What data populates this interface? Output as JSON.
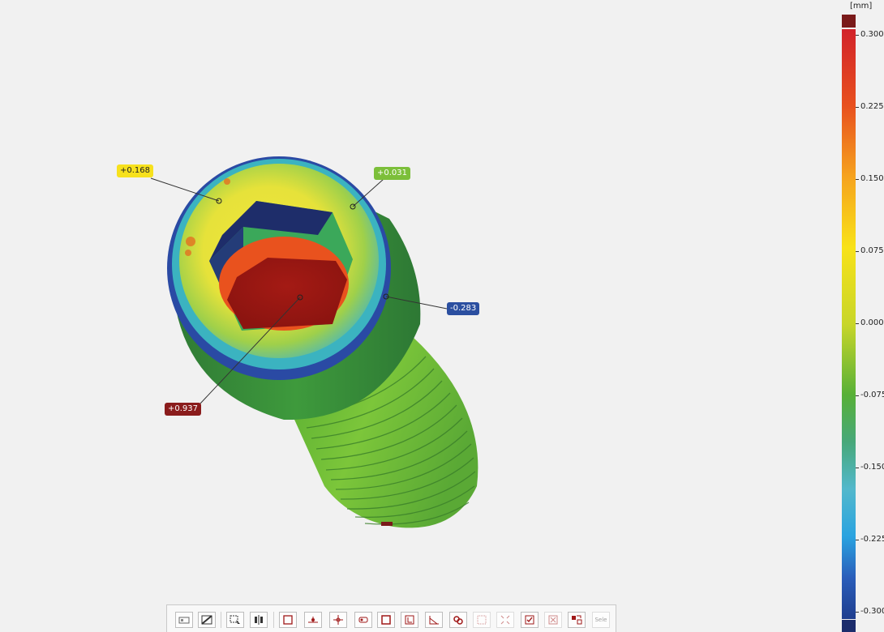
{
  "scale": {
    "unit": "[mm]",
    "ticks": [
      "0.300",
      "0.225",
      "0.150",
      "0.075",
      "0.000",
      "-0.075",
      "-0.150",
      "-0.225",
      "-0.300"
    ],
    "colors": {
      "over": "#7a1a1a",
      "under": "#1c2c6c"
    }
  },
  "labels": {
    "yellow": {
      "text": "+0.168",
      "bg": "#f7e11d",
      "fg": "#222222"
    },
    "green": {
      "text": "+0.031",
      "bg": "#7cbf3a",
      "fg": "#ffffff"
    },
    "blue": {
      "text": "-0.283",
      "bg": "#2b4fa0",
      "fg": "#ffffff"
    },
    "red": {
      "text": "+0.937",
      "bg": "#8a1c1c",
      "fg": "#ffffff"
    }
  },
  "toolbar": {
    "buttons": [
      "view-icon",
      "section-icon",
      "select-icon",
      "align-icon",
      "rectangle-icon",
      "point-icon",
      "cross-icon",
      "circle-icon",
      "frame-icon",
      "corner-icon",
      "angle-icon",
      "link-icon",
      "grid-icon",
      "shrink-icon",
      "check-icon",
      "close-icon",
      "merge-icon"
    ],
    "sele_label": "Sele"
  }
}
